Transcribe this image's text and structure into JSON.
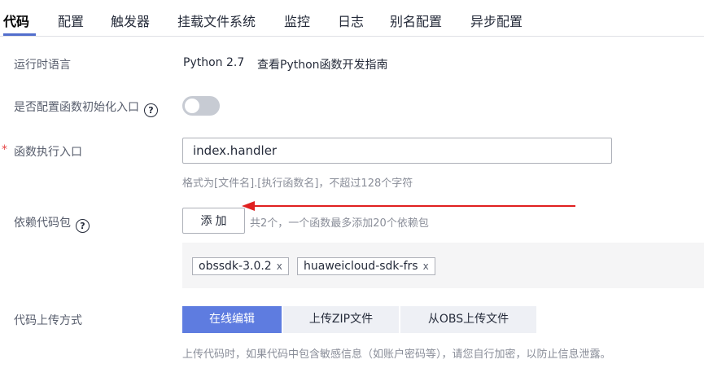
{
  "tabs": [
    {
      "label": "代码",
      "active": true
    },
    {
      "label": "配置"
    },
    {
      "label": "触发器"
    },
    {
      "label": "挂载文件系统"
    },
    {
      "label": "监控"
    },
    {
      "label": "日志"
    },
    {
      "label": "别名配置"
    },
    {
      "label": "异步配置"
    }
  ],
  "runtime": {
    "label": "运行时语言",
    "value": "Python 2.7",
    "guide_link": "查看Python函数开发指南"
  },
  "init_entry": {
    "label": "是否配置函数初始化入口",
    "help_icon": "?",
    "enabled": false
  },
  "handler": {
    "required_mark": "*",
    "label": "函数执行入口",
    "value": "index.handler",
    "hint": "格式为[文件名].[执行函数名]，不超过128个字符"
  },
  "dependencies": {
    "label": "依赖代码包",
    "help_icon": "?",
    "add_button": "添加",
    "summary": "共2个，一个函数最多添加20个依赖包",
    "items": [
      {
        "name": "obssdk-3.0.2",
        "remove": "x"
      },
      {
        "name": "huaweicloud-sdk-frs",
        "remove": "x"
      }
    ]
  },
  "upload": {
    "label": "代码上传方式",
    "options": [
      {
        "label": "在线编辑",
        "active": true
      },
      {
        "label": "上传ZIP文件"
      },
      {
        "label": "从OBS上传文件"
      }
    ],
    "hint": "上传代码时，如果代码中包含敏感信息（如账户密码等），请您自行加密，以防止信息泄露。"
  },
  "colors": {
    "accent": "#5e7ce0",
    "annotation_arrow": "#e02020",
    "required": "#e54545"
  }
}
